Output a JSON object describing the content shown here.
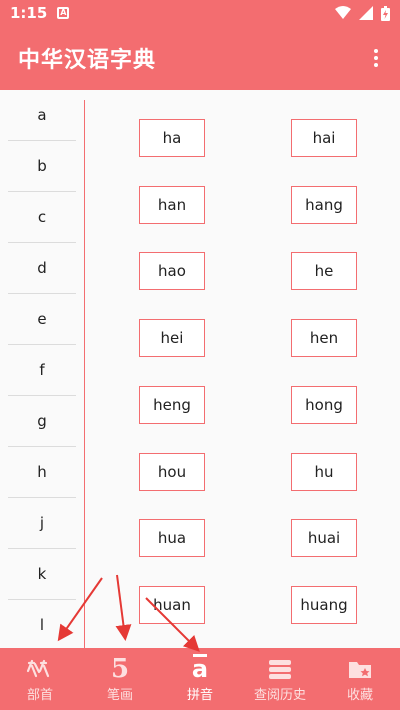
{
  "status_bar": {
    "time": "1:15",
    "a_badge": "A"
  },
  "app_bar": {
    "title": "中华汉语字典"
  },
  "letters": [
    "a",
    "b",
    "c",
    "d",
    "e",
    "f",
    "g",
    "h",
    "j",
    "k",
    "l"
  ],
  "pinyin": [
    "ha",
    "hai",
    "han",
    "hang",
    "hao",
    "he",
    "hei",
    "hen",
    "heng",
    "hong",
    "hou",
    "hu",
    "hua",
    "huai",
    "huan",
    "huang"
  ],
  "bottom_nav": [
    {
      "label": "部首",
      "icon": "radical-icon",
      "active": false
    },
    {
      "label": "笔画",
      "icon": "stroke-5-icon",
      "active": false
    },
    {
      "label": "拼音",
      "icon": "pinyin-a-icon",
      "active": true
    },
    {
      "label": "查阅历史",
      "icon": "history-books-icon",
      "active": false
    },
    {
      "label": "收藏",
      "icon": "favorites-folder-icon",
      "active": false
    }
  ],
  "colors": {
    "accent": "#f36d70",
    "arrow": "#e53935"
  }
}
